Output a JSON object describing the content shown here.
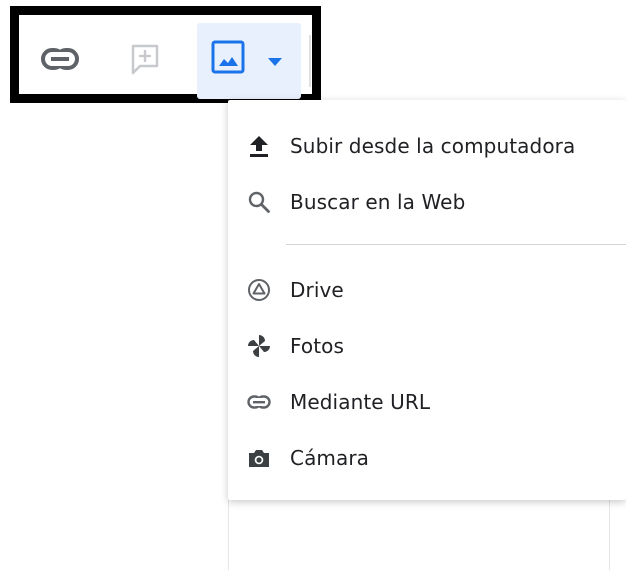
{
  "toolbar": {
    "link_icon": "link-icon",
    "comment_icon": "add-comment-icon",
    "image_icon": "insert-image-icon",
    "dropdown_icon": "caret-down-icon"
  },
  "menu": {
    "items": [
      {
        "label": "Subir desde la computadora",
        "icon": "upload-icon"
      },
      {
        "label": "Buscar en la Web",
        "icon": "search-icon"
      },
      {
        "label": "Drive",
        "icon": "drive-icon"
      },
      {
        "label": "Fotos",
        "icon": "photos-pinwheel-icon"
      },
      {
        "label": "Mediante URL",
        "icon": "link-icon"
      },
      {
        "label": "Cámara",
        "icon": "camera-icon"
      }
    ]
  },
  "colors": {
    "accent": "#1a73e8",
    "image_button_bg": "#e8f0fe",
    "icon_gray": "#5f6368",
    "text": "#202124",
    "frame_border": "#000000"
  }
}
